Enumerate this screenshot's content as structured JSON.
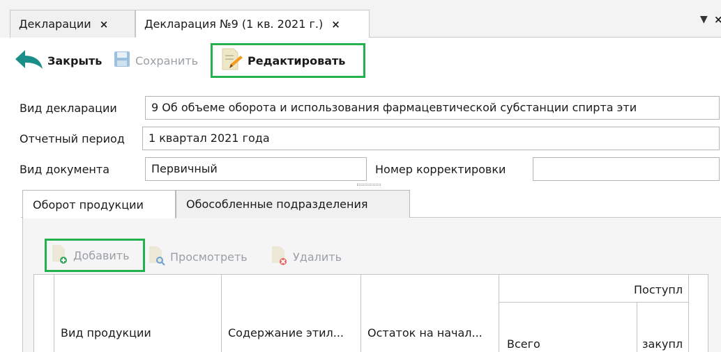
{
  "tabs": [
    {
      "label": "Декларации",
      "close": "×"
    },
    {
      "label": "Декларация №9 (1 кв. 2021 г.)",
      "close": "×"
    }
  ],
  "tabs_menu_glyph": "▼",
  "tabs_edge_glyph": "×",
  "toolbar": {
    "close_label": "Закрыть",
    "save_label": "Сохранить",
    "edit_label": "Редактировать"
  },
  "form": {
    "decl_type_label": "Вид декларации",
    "decl_type_value": "9 Об объеме оборота и использования фармацевтической субстанции спирта эти",
    "period_label": "Отчетный период",
    "period_value": "1 квартал 2021 года",
    "doc_type_label": "Вид документа",
    "doc_type_value": "Первичный",
    "correction_label": "Номер корректировки",
    "correction_value": ""
  },
  "inner_tabs": [
    "Оборот продукции",
    "Обособленные подразделения"
  ],
  "list_toolbar": {
    "add_label": "Добавить",
    "view_label": "Просмотреть",
    "delete_label": "Удалить"
  },
  "grid": {
    "columns": {
      "product_type": "Вид продукции",
      "ethyl_content": "Содержание этил...",
      "start_balance": "Остаток на начал...",
      "receipt_group": "Поступл",
      "total": "Всего",
      "purchase": "закупл"
    }
  },
  "colors": {
    "highlight": "#22b14c",
    "back_arrow": "#1a8f8a",
    "disabled_text": "#9aa0a6"
  }
}
